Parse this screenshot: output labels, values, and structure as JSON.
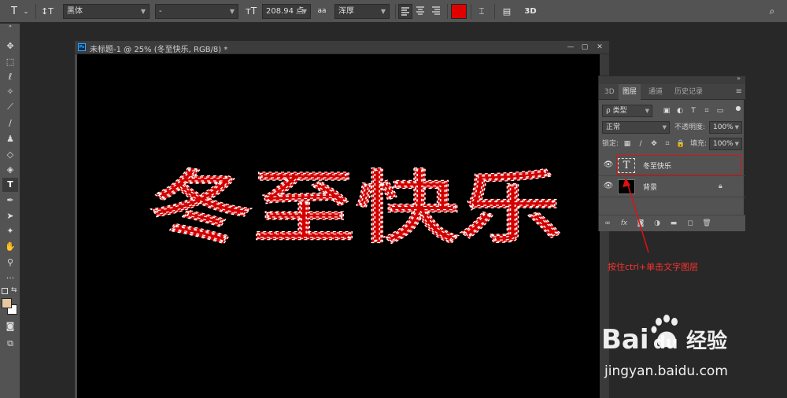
{
  "options_bar": {
    "font_family": "黑体",
    "font_style": "-",
    "font_size": "208.94 点",
    "aa_label": "aa",
    "antialias": "浑厚",
    "color": "#e00000",
    "three_d": "3D"
  },
  "document": {
    "title": "未标题-1 @ 25% (冬至快乐, RGB/8) *",
    "canvas_text": "冬至快乐",
    "text_color": "#d40000",
    "ps_badge": "Ps"
  },
  "layers_panel": {
    "tabs": [
      "3D",
      "图层",
      "通道",
      "历史记录"
    ],
    "active_tab": "图层",
    "filter_kind": "ρ 类型",
    "blend_mode": "正常",
    "opacity_label": "不透明度:",
    "opacity_value": "100%",
    "lock_label": "锁定:",
    "fill_label": "填充:",
    "fill_value": "100%",
    "layers": [
      {
        "name": "冬至快乐",
        "type": "text",
        "thumb": "T",
        "visible": true,
        "selected": true
      },
      {
        "name": "背景",
        "type": "background",
        "visible": true,
        "locked": true
      }
    ],
    "bottom_icons": [
      "link-icon",
      "fx-icon",
      "mask-icon",
      "adjustment-icon",
      "group-icon",
      "new-layer-icon",
      "trash-icon"
    ],
    "fx_label": "fx"
  },
  "annotation": {
    "text": "按住ctrl+单击文字图层",
    "color": "#ff3030"
  },
  "watermark": {
    "brand_latin_1": "Bai",
    "brand_latin_2": "du",
    "brand_cn": "经验",
    "url": "jingyan.baidu.com"
  }
}
